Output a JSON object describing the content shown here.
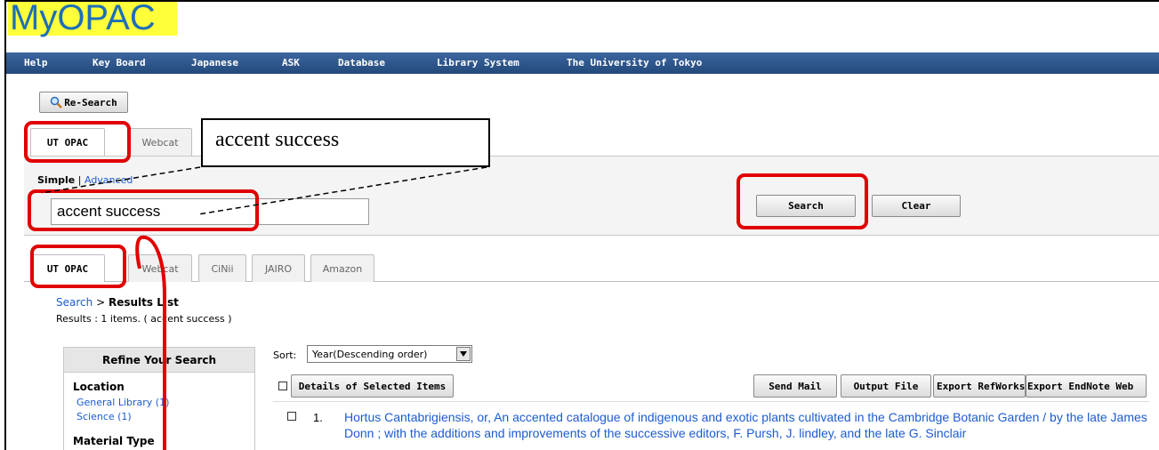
{
  "logo": {
    "text": "MyOPAC"
  },
  "nav": {
    "items": [
      "Help",
      "Key Board",
      "Japanese",
      "ASK",
      "Database",
      "Library System",
      "The University of Tokyo"
    ]
  },
  "research_button": "Re-Search",
  "search_tabs": [
    "UT OPAC",
    "Webcat"
  ],
  "callout_text": "accent success",
  "mode": {
    "simple": "Simple",
    "separator": "|",
    "advanced": "Advanced"
  },
  "search_input": {
    "value": "accent success"
  },
  "buttons": {
    "search": "Search",
    "clear": "Clear"
  },
  "result_tabs": [
    "UT OPAC",
    "Webcat",
    "CiNii",
    "JAIRO",
    "Amazon"
  ],
  "breadcrumb": {
    "search": "Search",
    "sep": ">",
    "current": "Results List"
  },
  "results_summary": "Results : 1 items. ( accent success )",
  "sort": {
    "label": "Sort:",
    "value": "Year(Descending order)"
  },
  "refine": {
    "title": "Refine Your Search",
    "location_label": "Location",
    "locations": [
      "General Library (1)",
      "Science (1)"
    ],
    "material_label": "Material Type"
  },
  "actions": {
    "details": "Details of Selected Items",
    "send_mail": "Send Mail",
    "output_file": "Output File",
    "export_refworks": "Export RefWorks",
    "export_endnote": "Export EndNote Web"
  },
  "results": [
    {
      "number": "1.",
      "title": "Hortus Cantabrigiensis, or, An accented catalogue of indigenous and exotic plants cultivated in the Cambridge Botanic Garden / by the late James Donn ; with the additions and improvements of the successive editors, F. Pursh, J. lindley, and the late G. Sinclair"
    }
  ],
  "colors": {
    "nav": "#2c5286",
    "logo_bg": "#ffff3a",
    "highlight": "#e00000",
    "link": "#1c5bd0"
  }
}
